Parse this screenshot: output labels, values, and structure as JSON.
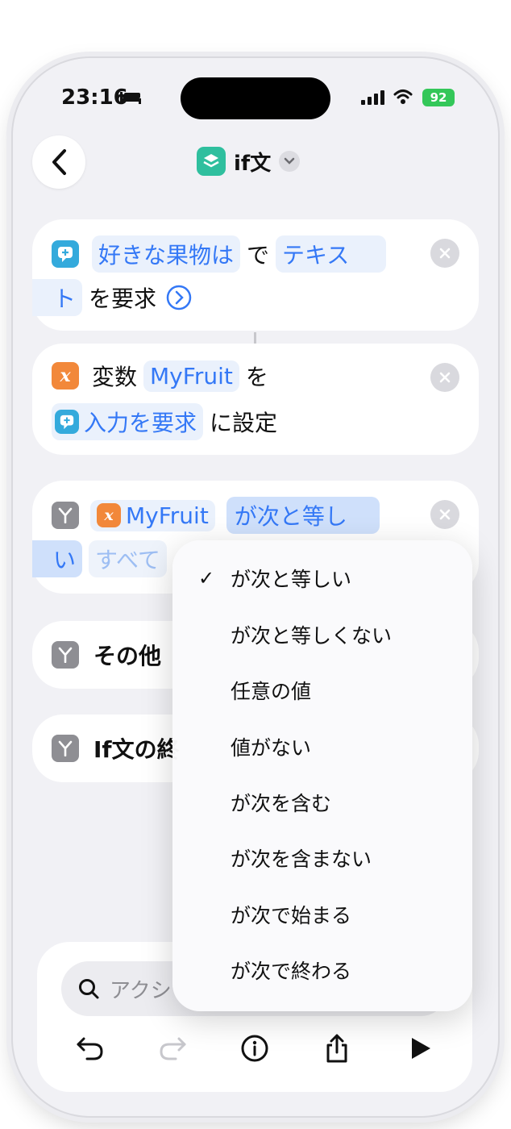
{
  "status_bar": {
    "time": "23:16",
    "battery": "92"
  },
  "nav": {
    "title": "if文"
  },
  "actions": [
    {
      "id": "ask",
      "parts": {
        "prompt": "好きな果物は",
        "de": "で",
        "type_a": "テキス",
        "type_b": "ト",
        "suffix": "を要求"
      }
    },
    {
      "id": "setvar",
      "parts": {
        "label": "変数",
        "var": "MyFruit",
        "wo": "を",
        "input_token": "入力を要求",
        "suffix": "に設定"
      }
    },
    {
      "id": "if",
      "parts": {
        "var": "MyFruit",
        "cond_a": "が次と等し",
        "cond_b": "い",
        "all": "すべて"
      }
    },
    {
      "id": "otherwise",
      "parts": {
        "label": "その他"
      }
    },
    {
      "id": "endif",
      "parts": {
        "label": "If文の終"
      }
    }
  ],
  "icons": {
    "ask": "ask-input-icon",
    "var": "variable-icon",
    "branch": "branch-icon"
  },
  "condition_menu": {
    "selected": "が次と等しい",
    "options": [
      "が次と等しい",
      "が次と等しくない",
      "任意の値",
      "値がない",
      "が次を含む",
      "が次を含まない",
      "が次で始まる",
      "が次で終わる"
    ]
  },
  "bottom": {
    "search_placeholder": "アクシ"
  },
  "colors": {
    "accent": "#3478f6",
    "cyan": "#34aadc",
    "orange": "#f2883a",
    "gray": "#8e8e93",
    "app_green": "#2fbf9e",
    "battery": "#34c759"
  }
}
